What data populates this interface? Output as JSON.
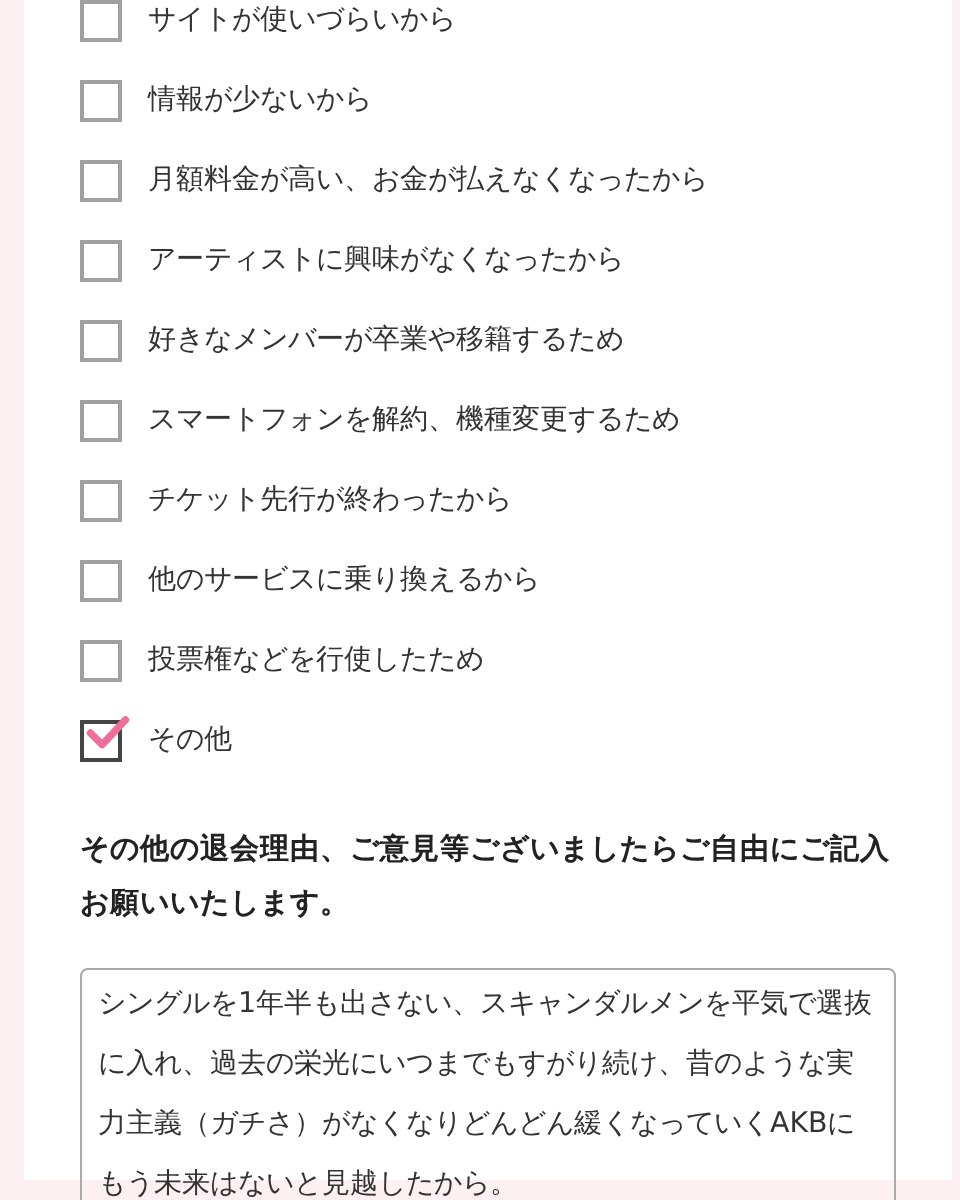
{
  "reasons": [
    {
      "label": "サイトが使いづらいから",
      "checked": false
    },
    {
      "label": "情報が少ないから",
      "checked": false
    },
    {
      "label": "月額料金が高い、お金が払えなくなったから",
      "checked": false
    },
    {
      "label": "アーティストに興味がなくなったから",
      "checked": false
    },
    {
      "label": "好きなメンバーが卒業や移籍するため",
      "checked": false
    },
    {
      "label": "スマートフォンを解約、機種変更するため",
      "checked": false
    },
    {
      "label": "チケット先行が終わったから",
      "checked": false
    },
    {
      "label": "他のサービスに乗り換えるから",
      "checked": false
    },
    {
      "label": "投票権などを行使したため",
      "checked": false
    },
    {
      "label": "その他",
      "checked": true
    }
  ],
  "comment": {
    "label": "その他の退会理由、ご意見等ございましたらご自由にご記入お願いいたします。",
    "value": "シングルを1年半も出さない、スキャンダルメンを平気で選抜に入れ、過去の栄光にいつまでもすがり続け、昔のような実力主義（ガチさ）がなくなりどんどん緩くなっていくAKBにもう未来はないと見越したから。"
  }
}
